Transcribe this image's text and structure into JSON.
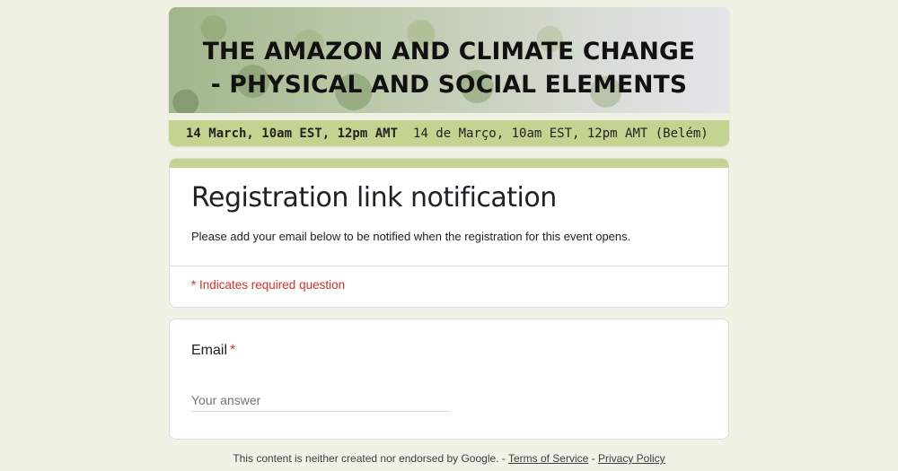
{
  "banner": {
    "title_line1": "THE AMAZON AND CLIMATE CHANGE",
    "title_line2": "- PHYSICAL AND SOCIAL ELEMENTS",
    "date_en": "14 March, 10am EST, 12pm AMT",
    "date_pt": "14 de Março, 10am EST, 12pm AMT (Belém)"
  },
  "form": {
    "title": "Registration link notification",
    "description": "Please add your email below to be notified when the registration for this event opens.",
    "required_note": "* Indicates required question"
  },
  "question": {
    "label": "Email",
    "required_mark": "*",
    "placeholder": "Your answer",
    "value": ""
  },
  "footer": {
    "text": "This content is neither created nor endorsed by Google.",
    "sep1": " - ",
    "terms_label": "Terms of Service",
    "sep2": " - ",
    "privacy_label": "Privacy Policy"
  },
  "colors": {
    "page_background": "#f0f2e6",
    "accent": "#c3d390",
    "required": "#d93025"
  }
}
